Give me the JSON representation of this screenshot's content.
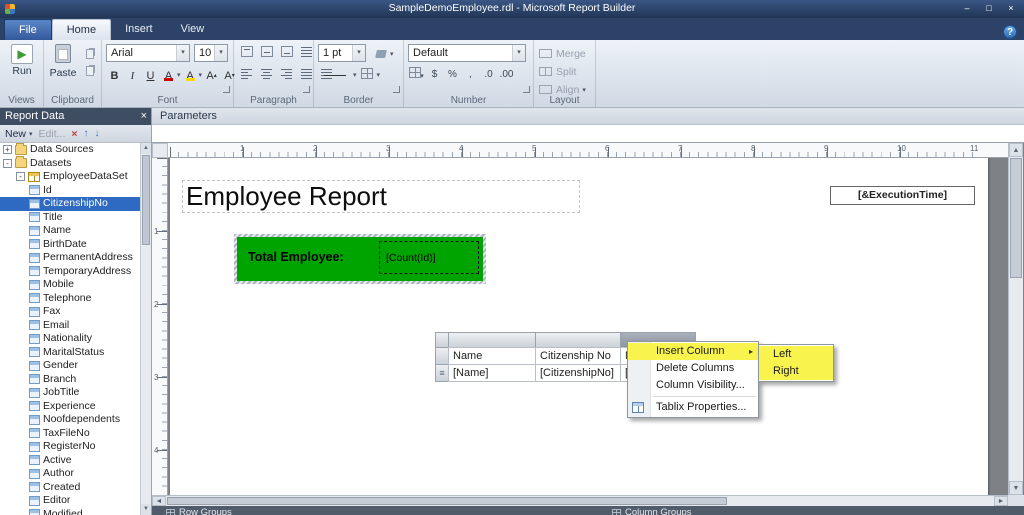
{
  "window": {
    "title": "SampleDemoEmployee.rdl - Microsoft Report Builder",
    "minimize": "–",
    "maximize": "□",
    "close": "×"
  },
  "ribbon": {
    "tabs": [
      {
        "id": "file",
        "label": "File",
        "active": false
      },
      {
        "id": "home",
        "label": "Home",
        "active": true
      },
      {
        "id": "insert",
        "label": "Insert",
        "active": false
      },
      {
        "id": "view",
        "label": "View",
        "active": false
      }
    ],
    "help": "?",
    "views": {
      "label": "Views",
      "run": "Run"
    },
    "clipboard": {
      "label": "Clipboard",
      "paste": "Paste"
    },
    "font": {
      "label": "Font",
      "family": "Arial",
      "size": "10",
      "bold": "B",
      "italic": "I",
      "underline": "U",
      "color": "A",
      "highlight": "A",
      "grow": "A",
      "shrink": "A"
    },
    "paragraph": {
      "label": "Paragraph"
    },
    "border": {
      "label": "Border",
      "width": "1 pt"
    },
    "number": {
      "label": "Number",
      "format": "Default",
      "currency": "$",
      "percent": "%",
      "comma": ",",
      "dec_left": ".0",
      "dec_right": ".00"
    },
    "layout": {
      "label": "Layout",
      "merge": "Merge",
      "split": "Split",
      "align": "Align"
    }
  },
  "report_data": {
    "title": "Report Data",
    "close": "×",
    "new": "New",
    "edit": "Edit...",
    "tree": [
      {
        "label": "Data Sources",
        "level": 0,
        "icon": "folder",
        "expand": "+"
      },
      {
        "label": "Datasets",
        "level": 0,
        "icon": "folder",
        "expand": "-"
      },
      {
        "label": "EmployeeDataSet",
        "level": 1,
        "icon": "dataset",
        "expand": "-"
      },
      {
        "label": "Id",
        "level": 2,
        "icon": "field"
      },
      {
        "label": "CitizenshipNo",
        "level": 2,
        "icon": "field",
        "selected": true
      },
      {
        "label": "Title",
        "level": 2,
        "icon": "field"
      },
      {
        "label": "Name",
        "level": 2,
        "icon": "field"
      },
      {
        "label": "BirthDate",
        "level": 2,
        "icon": "field"
      },
      {
        "label": "PermanentAddress",
        "level": 2,
        "icon": "field"
      },
      {
        "label": "TemporaryAddress",
        "level": 2,
        "icon": "field"
      },
      {
        "label": "Mobile",
        "level": 2,
        "icon": "field"
      },
      {
        "label": "Telephone",
        "level": 2,
        "icon": "field"
      },
      {
        "label": "Fax",
        "level": 2,
        "icon": "field"
      },
      {
        "label": "Email",
        "level": 2,
        "icon": "field"
      },
      {
        "label": "Nationality",
        "level": 2,
        "icon": "field"
      },
      {
        "label": "MaritalStatus",
        "level": 2,
        "icon": "field"
      },
      {
        "label": "Gender",
        "level": 2,
        "icon": "field"
      },
      {
        "label": "Branch",
        "level": 2,
        "icon": "field"
      },
      {
        "label": "JobTitle",
        "level": 2,
        "icon": "field"
      },
      {
        "label": "Experience",
        "level": 2,
        "icon": "field"
      },
      {
        "label": "Noofdependents",
        "level": 2,
        "icon": "field"
      },
      {
        "label": "TaxFileNo",
        "level": 2,
        "icon": "field"
      },
      {
        "label": "RegisterNo",
        "level": 2,
        "icon": "field"
      },
      {
        "label": "Active",
        "level": 2,
        "icon": "field"
      },
      {
        "label": "Author",
        "level": 2,
        "icon": "field"
      },
      {
        "label": "Created",
        "level": 2,
        "icon": "field"
      },
      {
        "label": "Editor",
        "level": 2,
        "icon": "field"
      },
      {
        "label": "Modified",
        "level": 2,
        "icon": "field"
      }
    ]
  },
  "parameters": {
    "label": "Parameters"
  },
  "design": {
    "h_ruler": [
      "1",
      "2",
      "3",
      "4",
      "5",
      "6",
      "7",
      "8",
      "9",
      "10",
      "11"
    ],
    "v_ruler": [
      "1",
      "2",
      "3",
      "4"
    ],
    "title_textbox": "Employee Report",
    "execution_time": "[&ExecutionTime]",
    "total_label": "Total Employee:",
    "total_value": "[Count(Id)]",
    "table": {
      "headers": [
        "Name",
        "Citizenship No",
        "Nation"
      ],
      "values": [
        "[Name]",
        "[CitizenshipNo]",
        "[Nation"
      ]
    }
  },
  "context_menu": {
    "items": [
      {
        "label": "Insert Column",
        "arrow": true,
        "highlight": true
      },
      {
        "label": "Delete Columns"
      },
      {
        "label": "Column Visibility..."
      },
      {
        "separator": true
      },
      {
        "label": "Tablix Properties...",
        "icon": "tablix-properties"
      }
    ],
    "submenu": [
      {
        "label": "Left",
        "highlight": true
      },
      {
        "label": "Right",
        "highlight": true
      }
    ]
  },
  "groups_pane": {
    "row_groups": "Row Groups",
    "column_groups": "Column Groups"
  },
  "colors": {
    "accent_green": "#00a400",
    "menu_highlight": "#f9f44d",
    "selection_blue": "#2e6ac1"
  }
}
